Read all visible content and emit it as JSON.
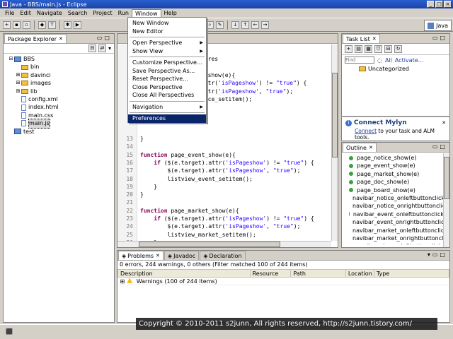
{
  "window": {
    "title": "Java - BBS/main.js - Eclipse",
    "min": "_",
    "max": "□",
    "close": "×"
  },
  "menubar": [
    "File",
    "Edit",
    "Navigate",
    "Search",
    "Project",
    "Run",
    "Window",
    "Help"
  ],
  "perspective": {
    "label": "Java"
  },
  "window_menu": {
    "items": [
      {
        "label": "New Window",
        "arrow": false
      },
      {
        "label": "New Editor",
        "arrow": false
      },
      {
        "sep": true
      },
      {
        "label": "Open Perspective",
        "arrow": true
      },
      {
        "label": "Show View",
        "arrow": true
      },
      {
        "sep": true
      },
      {
        "label": "Customize Perspective...",
        "arrow": false
      },
      {
        "label": "Save Perspective As...",
        "arrow": false
      },
      {
        "label": "Reset Perspective...",
        "arrow": false
      },
      {
        "label": "Close Perspective",
        "arrow": false
      },
      {
        "label": "Close All Perspectives",
        "arrow": false
      },
      {
        "sep": true
      },
      {
        "label": "Navigation",
        "arrow": true
      },
      {
        "sep": true
      },
      {
        "label": "Preferences",
        "arrow": false,
        "selected": true
      }
    ]
  },
  "package_explorer": {
    "tab": "Package Explorer",
    "tree": [
      {
        "label": "BBS",
        "type": "proj",
        "indent": 0,
        "exp": "⊟"
      },
      {
        "label": "bin",
        "type": "folder",
        "indent": 1,
        "exp": ""
      },
      {
        "label": "davinci",
        "type": "folder",
        "indent": 1,
        "exp": "⊞"
      },
      {
        "label": "images",
        "type": "folder",
        "indent": 1,
        "exp": "⊞"
      },
      {
        "label": "lib",
        "type": "folder",
        "indent": 1,
        "exp": "⊞"
      },
      {
        "label": "config.xml",
        "type": "file",
        "indent": 1,
        "exp": ""
      },
      {
        "label": "index.html",
        "type": "file",
        "indent": 1,
        "exp": ""
      },
      {
        "label": "main.css",
        "type": "file",
        "indent": 1,
        "exp": ""
      },
      {
        "label": "main.js",
        "type": "file",
        "indent": 1,
        "exp": "",
        "selected": true
      },
      {
        "label": "test",
        "type": "proj",
        "indent": 0,
        "exp": ""
      }
    ]
  },
  "editor": {
    "fragments": [
      {
        "line": 1,
        "text": "ncres"
      },
      {
        "line": 3,
        "text": "e_show(e){"
      },
      {
        "line": 4,
        "text": "attr('isPageshow') != \"true\") {"
      },
      {
        "line": 5,
        "text": "attr('isPageshow', \"true\");"
      },
      {
        "line": 6,
        "text": "tice_setitem();"
      }
    ],
    "lines": [
      {
        "n": "13",
        "code": "}"
      },
      {
        "n": "14",
        "code": ""
      },
      {
        "n": "15",
        "code": "function page_event_show(e){"
      },
      {
        "n": "16",
        "code": "    if ($(e.target).attr('isPageshow') != \"true\") {"
      },
      {
        "n": "17",
        "code": "        $(e.target).attr('isPageshow', \"true\");"
      },
      {
        "n": "18",
        "code": "        listview_event_setitem();"
      },
      {
        "n": "19",
        "code": "    }"
      },
      {
        "n": "20",
        "code": "}"
      },
      {
        "n": "21",
        "code": ""
      },
      {
        "n": "22",
        "code": "function page_market_show(e){"
      },
      {
        "n": "23",
        "code": "    if ($(e.target).attr('isPageshow') != \"true\") {"
      },
      {
        "n": "24",
        "code": "        $(e.target).attr('isPageshow', \"true\");"
      },
      {
        "n": "25",
        "code": "        listview_market_setitem();"
      },
      {
        "n": "26",
        "code": "    }"
      },
      {
        "n": "27",
        "code": "}"
      }
    ]
  },
  "task_list": {
    "tab": "Task List",
    "find_placeholder": "Find",
    "all": "All",
    "activate": "Activate...",
    "uncategorized": "Uncategorized"
  },
  "mylyn": {
    "title": "Connect Mylyn",
    "link": "Connect",
    "text": "to your task and ALM tools."
  },
  "outline": {
    "tab": "Outline",
    "items": [
      "page_notice_show(e)",
      "page_event_show(e)",
      "page_market_show(e)",
      "page_doc_show(e)",
      "page_board_show(e)",
      "navibar_notice_onleftbuttonclick",
      "navibar_notice_onrightbuttonclick",
      "navibar_event_onleftbuttonclick",
      "navibar_event_onrightbuttonclick",
      "navibar_market_onleftbuttonclick",
      "navibar_market_onrightbuttonclick",
      "navibar_doc_onleftbuttonclick"
    ]
  },
  "bottom": {
    "tabs": [
      "Problems",
      "Javadoc",
      "Declaration"
    ],
    "summary": "0 errors, 244 warnings, 0 others (Filter matched 100 of 244 items)",
    "columns": [
      "Description",
      "Resource",
      "Path",
      "Location",
      "Type"
    ],
    "group": "Warnings (100 of 244 items)"
  },
  "copyright": "Copyright © 2010-2011 s2junn, All rights reserved, http://s2junn.tistory.com/"
}
